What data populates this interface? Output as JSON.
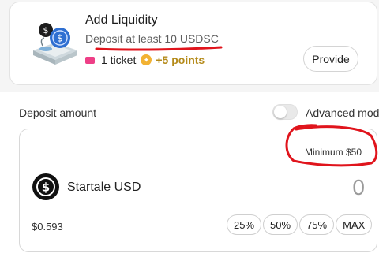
{
  "liquidity_card": {
    "title": "Add Liquidity",
    "subtitle": "Deposit at least 10 USDSC",
    "ticket_text": "1 ticket",
    "points_text": "+5 points",
    "provide_label": "Provide"
  },
  "deposit": {
    "label": "Deposit amount",
    "advanced_mode_label": "Advanced mode",
    "advanced_mode_on": false,
    "minimum_text": "Minimum $50",
    "token_name": "Startale USD",
    "amount_value": "0",
    "usd_value": "$0.593",
    "percent_buttons": [
      "25%",
      "50%",
      "75%",
      "MAX"
    ]
  },
  "colors": {
    "annotation_red": "#e0141c",
    "ticket_pink": "#ee3f87",
    "points_gold": "#b48a19"
  },
  "icons": {
    "illustration": "coins-platform-illustration",
    "ticket": "ticket-icon",
    "points": "points-coin-icon",
    "token": "startale-usd-token-icon"
  }
}
